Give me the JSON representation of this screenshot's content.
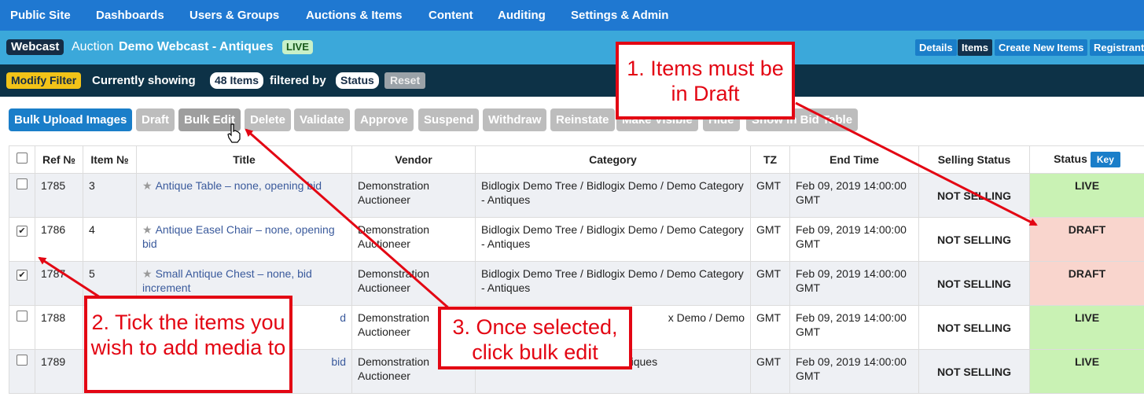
{
  "topnav": {
    "items": [
      "Public Site",
      "Dashboards",
      "Users & Groups",
      "Auctions & Items",
      "Content",
      "Auditing",
      "Settings & Admin"
    ]
  },
  "auction": {
    "type_label": "Webcast",
    "prefix": "Auction",
    "name": "Demo Webcast - Antiques",
    "state": "LIVE",
    "tabs": [
      "Details",
      "Items",
      "Create New Items",
      "Registrant"
    ]
  },
  "filter": {
    "modify_label": "Modify Filter",
    "showing_text": "Currently showing",
    "count": "48 Items",
    "filtered_by": "filtered by",
    "filter_value": "Status",
    "reset_label": "Reset"
  },
  "toolbar": {
    "buttons": [
      "Bulk Upload Images",
      "Draft",
      "Bulk Edit",
      "Delete",
      "Validate",
      "Approve",
      "Suspend",
      "Withdraw",
      "Reinstate",
      "Make Visible",
      "Hide",
      "Show in Bid Table"
    ]
  },
  "table": {
    "headers": [
      "",
      "Ref №",
      "Item №",
      "Title",
      "Vendor",
      "Category",
      "TZ",
      "End Time",
      "Selling Status",
      "Status"
    ],
    "key_label": "Key",
    "rows": [
      {
        "checked": false,
        "ref": "1785",
        "item": "3",
        "title": "Antique Table – none, opening bid",
        "vendor": "Demonstration Auctioneer",
        "category": "Bidlogix Demo Tree / Bidlogix Demo / Demo Category - Antiques",
        "tz": "GMT",
        "end_time": "Feb 09, 2019 14:00:00 GMT",
        "selling": "NOT SELLING",
        "status": "LIVE"
      },
      {
        "checked": true,
        "ref": "1786",
        "item": "4",
        "title": "Antique Easel Chair – none, opening bid",
        "vendor": "Demonstration Auctioneer",
        "category": "Bidlogix Demo Tree / Bidlogix Demo / Demo Category - Antiques",
        "tz": "GMT",
        "end_time": "Feb 09, 2019 14:00:00 GMT",
        "selling": "NOT SELLING",
        "status": "DRAFT"
      },
      {
        "checked": true,
        "ref": "1787",
        "item": "5",
        "title": "Small Antique Chest – none, bid increment",
        "vendor": "Demonstration Auctioneer",
        "category": "Bidlogix Demo Tree / Bidlogix Demo / Demo Category - Antiques",
        "tz": "GMT",
        "end_time": "Feb 09, 2019 14:00:00 GMT",
        "selling": "NOT SELLING",
        "status": "DRAFT"
      },
      {
        "checked": false,
        "ref": "1788",
        "item": "",
        "title": "d",
        "vendor": "Demonstration Auctioneer",
        "category": "x Demo / Demo",
        "tz": "GMT",
        "end_time": "Feb 09, 2019 14:00:00 GMT",
        "selling": "NOT SELLING",
        "status": "LIVE"
      },
      {
        "checked": false,
        "ref": "1789",
        "item": "",
        "title": "bid",
        "vendor": "Demonstration Auctioneer",
        "category": "x Demo / Demo Category - Antiques",
        "tz": "GMT",
        "end_time": "Feb 09, 2019 14:00:00 GMT",
        "selling": "NOT SELLING",
        "status": "LIVE"
      }
    ]
  },
  "annotations": {
    "callout1": "1. Items must be in Draft",
    "callout2": "2. Tick the items you wish to add media to",
    "callout3": "3. Once selected, click bulk edit"
  },
  "colors": {
    "nav_blue": "#1f78d1",
    "auction_bar": "#3ba8da",
    "filter_bar": "#0d3247",
    "annotation_red": "#e30613",
    "live_green": "#c9f2b4",
    "draft_pink": "#f9d5cd"
  }
}
